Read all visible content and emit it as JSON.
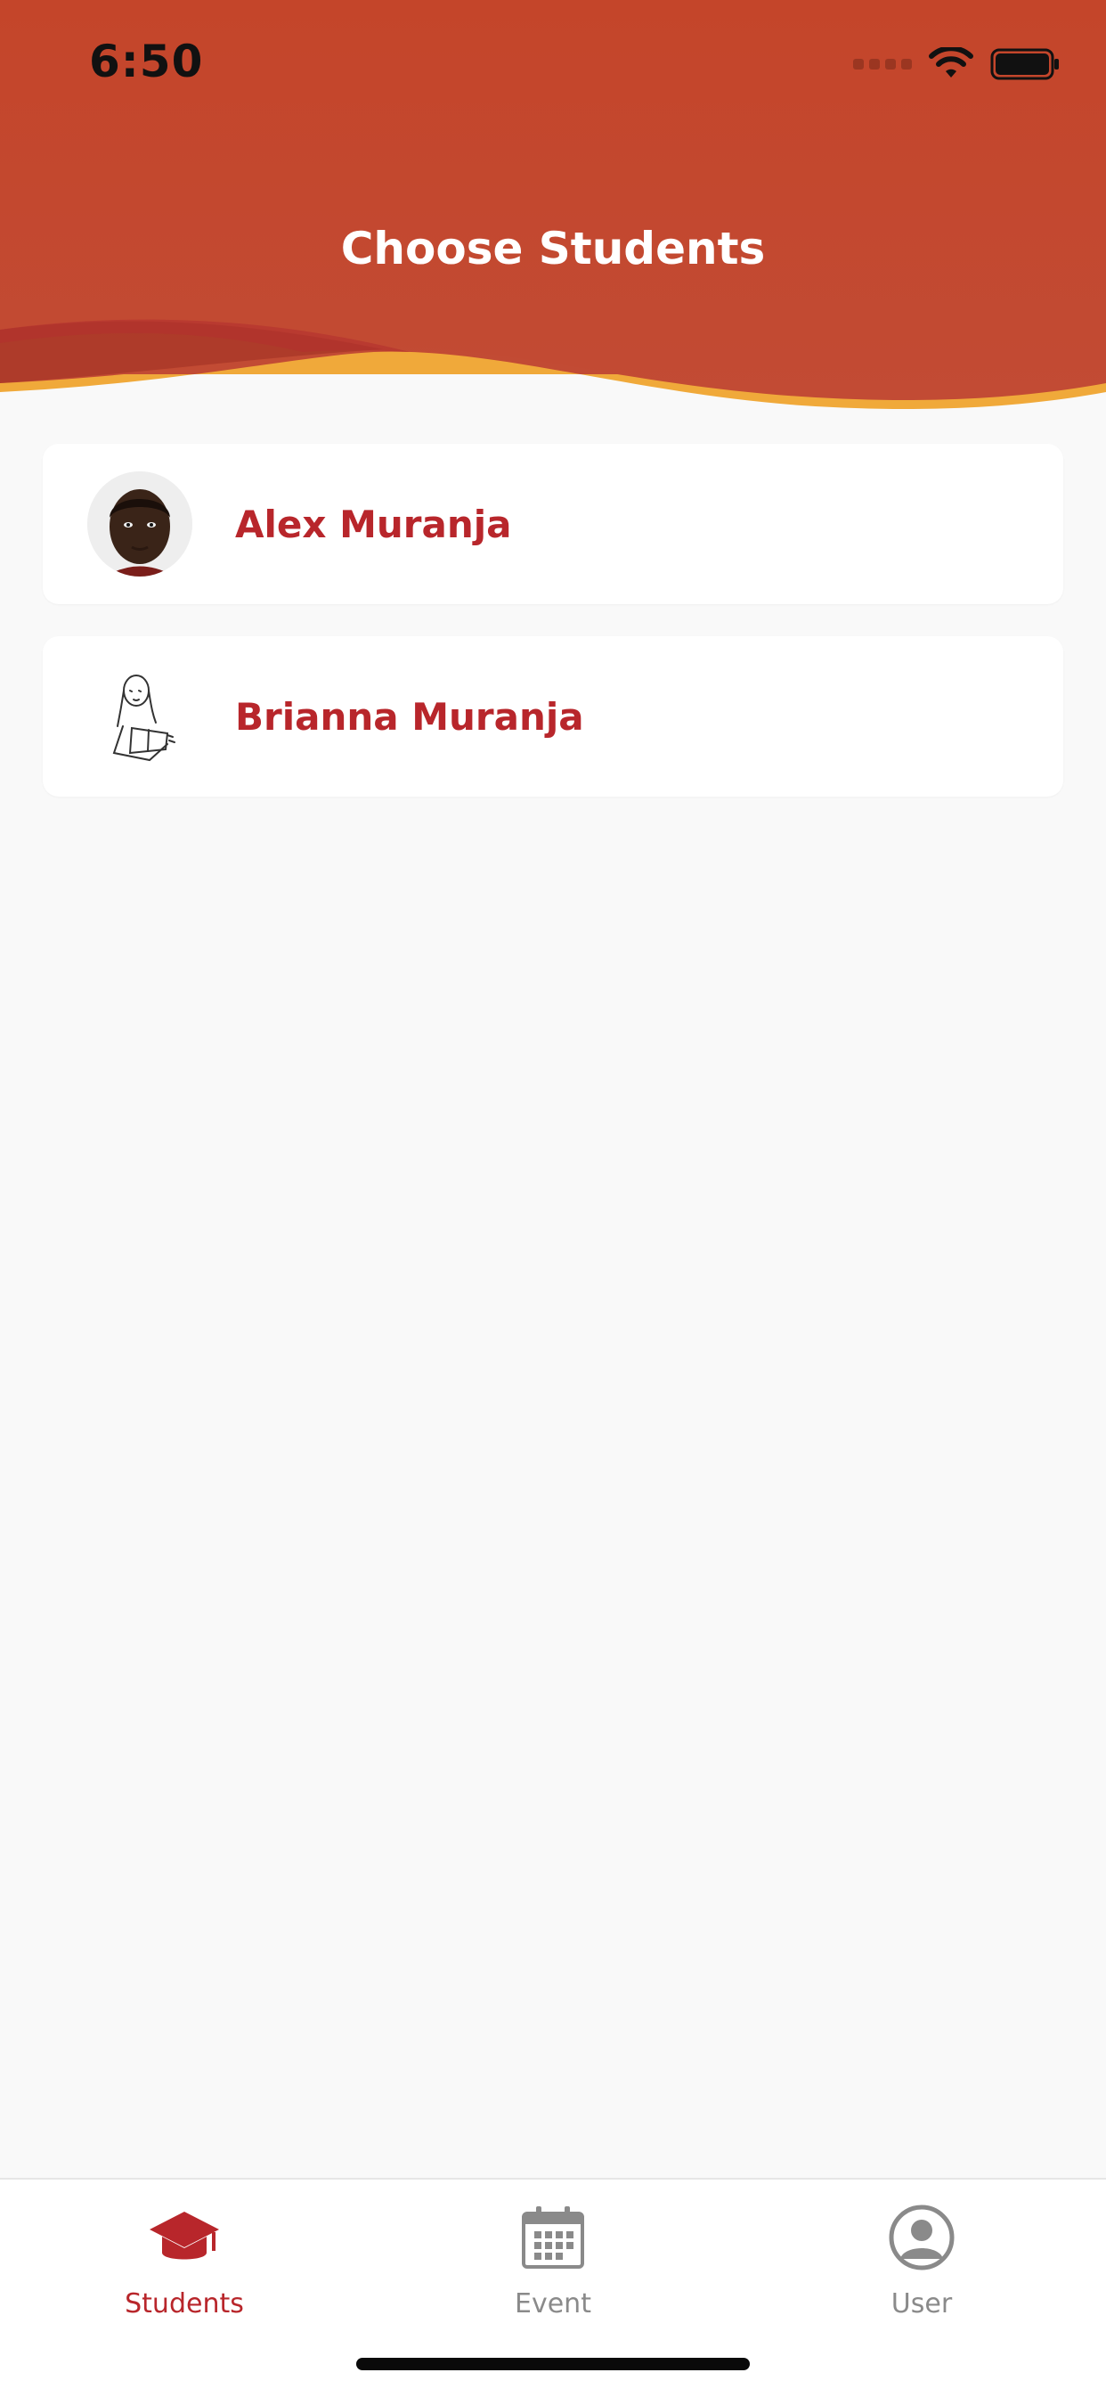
{
  "status_bar": {
    "time": "6:50"
  },
  "header": {
    "title": "Choose Students"
  },
  "students": [
    {
      "name": "Alex Muranja",
      "avatar": "photo"
    },
    {
      "name": "Brianna Muranja",
      "avatar": "sketch"
    }
  ],
  "tabbar": {
    "tabs": [
      {
        "label": "Students",
        "icon": "graduation-cap-icon",
        "active": true
      },
      {
        "label": "Event",
        "icon": "calendar-icon",
        "active": false
      },
      {
        "label": "User",
        "icon": "user-icon",
        "active": false
      }
    ]
  },
  "colors": {
    "header_red": "#c4452a",
    "accent_yellow": "#f0a93a",
    "name_red": "#b8262b",
    "tab_inactive": "#8a8a8a"
  }
}
